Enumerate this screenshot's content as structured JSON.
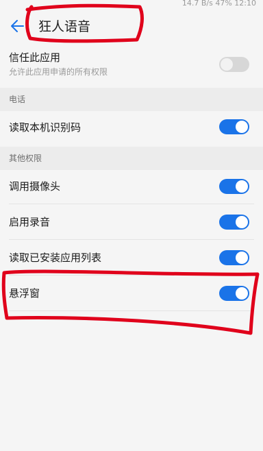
{
  "status": {
    "text": "14.7 B/s  47%  12:10"
  },
  "header": {
    "title": "狂人语音",
    "back_icon": "back-arrow-icon"
  },
  "trust": {
    "label": "信任此应用",
    "sub": "允许此应用申请的所有权限",
    "enabled": false
  },
  "sections": [
    {
      "title": "电话",
      "items": [
        {
          "label": "读取本机识别码",
          "enabled": true
        }
      ]
    },
    {
      "title": "其他权限",
      "items": [
        {
          "label": "调用摄像头",
          "enabled": true
        },
        {
          "label": "启用录音",
          "enabled": true
        },
        {
          "label": "读取已安装应用列表",
          "enabled": true
        },
        {
          "label": "悬浮窗",
          "enabled": true
        }
      ]
    }
  ],
  "colors": {
    "accent": "#1a73e8",
    "annotation": "#e0001b",
    "background": "#f5f5f5"
  }
}
